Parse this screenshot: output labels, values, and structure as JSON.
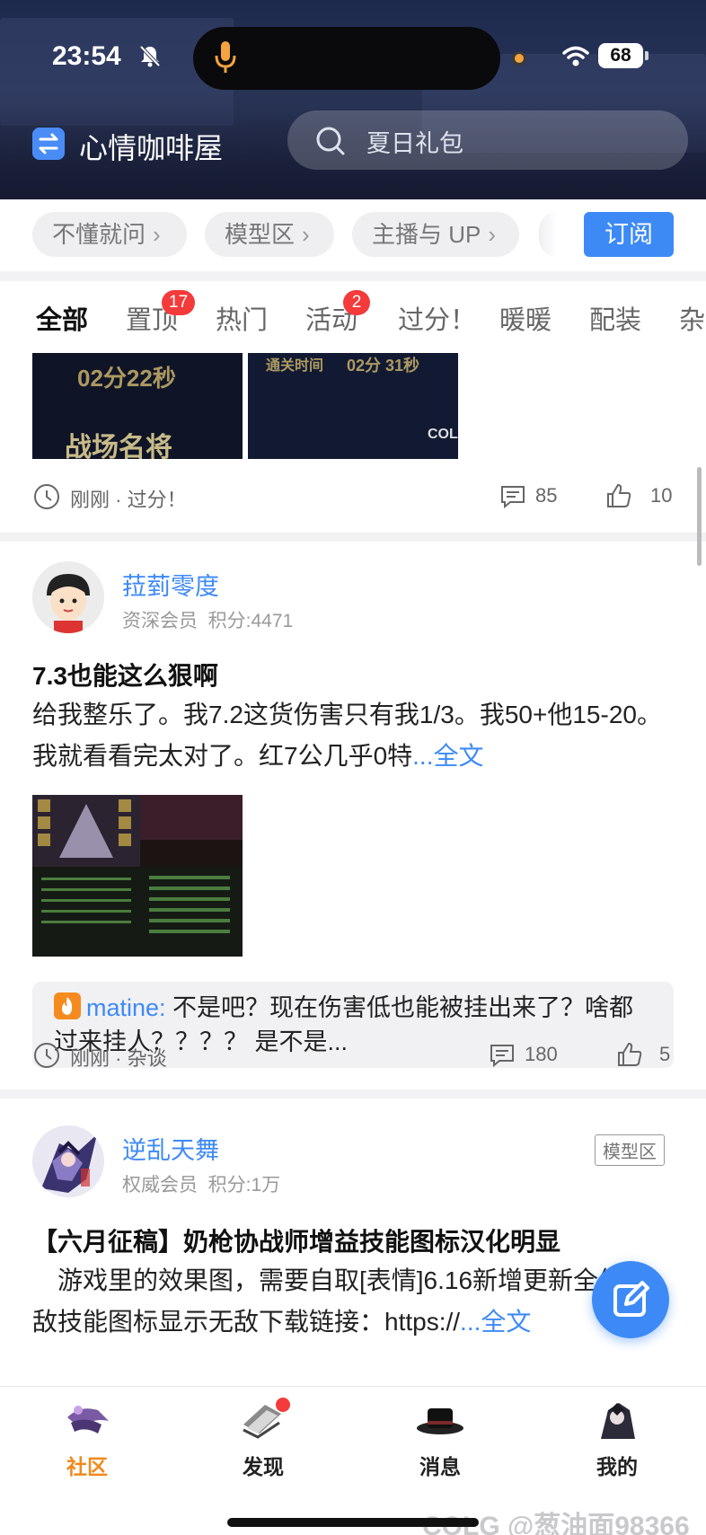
{
  "status_bar": {
    "time": "23:54",
    "battery": "68"
  },
  "header": {
    "forum_title": "心情咖啡屋",
    "search_placeholder": "夏日礼包"
  },
  "chips": [
    {
      "label": "不懂就问"
    },
    {
      "label": "模型区"
    },
    {
      "label": "主播与 UP"
    }
  ],
  "subscribe_label": "订阅",
  "tabs": [
    {
      "label": "全部",
      "badge": ""
    },
    {
      "label": "置顶",
      "badge": "17"
    },
    {
      "label": "热门",
      "badge": ""
    },
    {
      "label": "活动",
      "badge": "2"
    },
    {
      "label": "过分！",
      "badge": ""
    },
    {
      "label": "暖暖",
      "badge": ""
    },
    {
      "label": "配装",
      "badge": ""
    },
    {
      "label": "杂",
      "badge": ""
    }
  ],
  "feed": {
    "post1": {
      "thumb1_text": "02分22秒",
      "thumb1_text2": "战场名将",
      "thumb2_text": "02分 31秒",
      "thumb2_text_top": "通关时间",
      "thumb2_logo": "COL",
      "time": "刚刚",
      "category": "过分！",
      "comments": "85",
      "likes": "10"
    },
    "post2": {
      "username": "菈菿零度",
      "level": "资深会员",
      "points": "积分:4471",
      "title": "7.3也能这么狠啊",
      "body": "给我整乐了。我7.2这货伤害只有我1/3。我50+他15-20。我就看看完太对了。红7公几乎0特",
      "more": "...全文",
      "comment_user": "matine:",
      "comment_text": " 不是吧？现在伤害低也能被挂出来了？啥都过来挂人？？？？ 是不是...",
      "time": "刚刚",
      "category": "杂谈",
      "comments": "180",
      "likes": "5"
    },
    "post3": {
      "username": "逆乱天舞",
      "level": "权威会员",
      "points": "积分:1万",
      "tag": "模型区",
      "title": "【六月征稿】奶枪协战师增益技能图标汉化明显",
      "body": "　游戏里的效果图，需要自取[表情]6.16新增更新全体无敌技能图标显示无敌下载链接：https://",
      "more": "...全文"
    }
  },
  "bottom_nav": [
    {
      "label": "社区"
    },
    {
      "label": "发现"
    },
    {
      "label": "消息"
    },
    {
      "label": "我的"
    }
  ],
  "watermark": "COLG @葱油面98366",
  "colors": {
    "accent": "#3d8af7",
    "active_nav": "#f08a1c",
    "badge": "#f43a3a"
  }
}
